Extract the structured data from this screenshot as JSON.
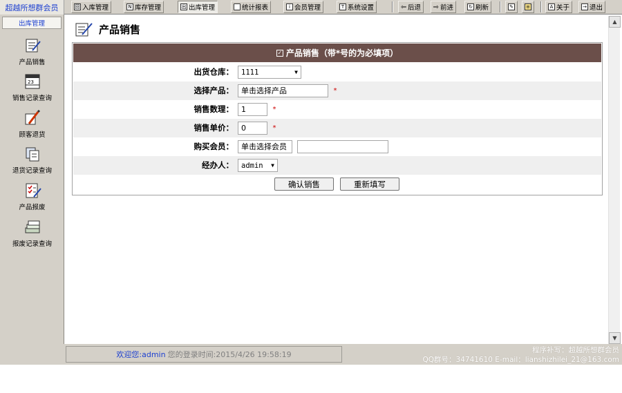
{
  "brand": "超越所想群会员",
  "toolbar": {
    "items": [
      {
        "label": "入库管理",
        "icon": "inbound-icon"
      },
      {
        "label": "库存管理",
        "icon": "inventory-icon"
      },
      {
        "label": "出库管理",
        "icon": "outbound-icon"
      },
      {
        "label": "统计报表",
        "icon": "folder-icon"
      },
      {
        "label": "会员管理",
        "icon": "member-icon"
      },
      {
        "label": "系统设置",
        "icon": "settings-icon"
      },
      {
        "label": "后退",
        "icon": "back-arrow-icon"
      },
      {
        "label": "前进",
        "icon": "forward-arrow-icon"
      },
      {
        "label": "刷新",
        "icon": "refresh-icon"
      },
      {
        "label": "",
        "icon": "edit-icon"
      },
      {
        "label": "",
        "icon": "notes-icon"
      },
      {
        "label": "关于",
        "icon": "about-icon"
      },
      {
        "label": "退出",
        "icon": "exit-icon"
      }
    ]
  },
  "sidebar": {
    "title": "出库管理",
    "items": [
      {
        "label": "产品销售",
        "icon": "product-sale-icon"
      },
      {
        "label": "销售记录查询",
        "icon": "calendar-icon"
      },
      {
        "label": "顾客退货",
        "icon": "pencil-icon"
      },
      {
        "label": "退货记录查询",
        "icon": "copy-pages-icon"
      },
      {
        "label": "产品报废",
        "icon": "checklist-icon"
      },
      {
        "label": "报废记录查询",
        "icon": "stack-icon"
      }
    ]
  },
  "page": {
    "title": "产品销售"
  },
  "form": {
    "header": "产品销售（带*号的为必填项）",
    "warehouse": {
      "label": "出货仓库：",
      "value": "1111"
    },
    "product": {
      "label": "选择产品：",
      "value": "单击选择产品"
    },
    "quantity": {
      "label": "销售数理：",
      "value": "1"
    },
    "price": {
      "label": "销售单价：",
      "value": "0"
    },
    "member": {
      "label": "购买会员：",
      "value": "单击选择会员",
      "extra_value": ""
    },
    "handler": {
      "label": "经办人：",
      "value": "admin"
    },
    "required_mark": "*",
    "submit_label": "确认销售",
    "reset_label": "重新填写"
  },
  "status": {
    "welcome": "欢迎您:admin",
    "login_time": "您的登录时间:2015/4/26 19:58:19",
    "credit_line1": "程序补写：超越所想群会员",
    "credit_line2": "QQ群号：34741610 E-mail：lianshizhilei_21@163.com"
  },
  "colors": {
    "form_header_bg": "#6b4f4a",
    "brand_text": "#1c3fd0",
    "required": "#cc0000"
  }
}
